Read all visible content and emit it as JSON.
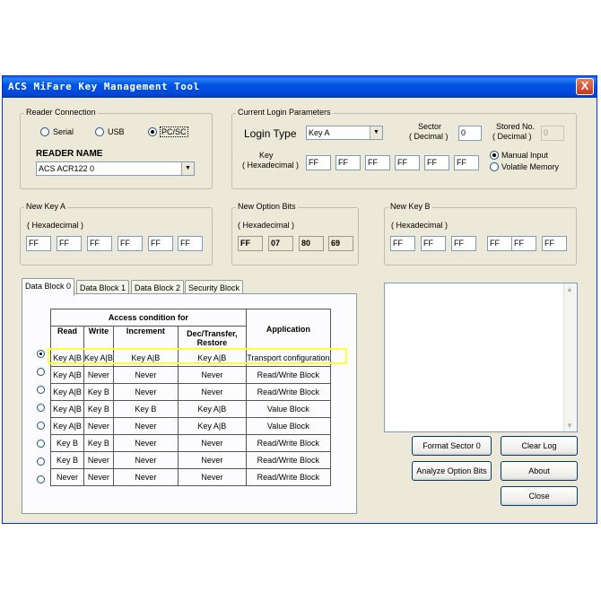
{
  "window": {
    "title": "ACS MiFare Key Management Tool",
    "close_label": "X"
  },
  "reader_connection": {
    "legend": "Reader Connection",
    "options": [
      "Serial",
      "USB",
      "PC/SC"
    ],
    "selected": "PC/SC",
    "reader_name_label": "READER NAME",
    "reader_name_value": "ACS ACR122 0"
  },
  "login": {
    "legend": "Current Login Parameters",
    "login_type_label": "Login Type",
    "login_type_value": "Key A",
    "sector_label_1": "Sector",
    "sector_label_2": "( Decimal )",
    "sector_value": "0",
    "stored_label_1": "Stored No.",
    "stored_label_2": "( Decimal )",
    "stored_value": "0",
    "key_label_1": "Key",
    "key_label_2": "( Hexadecimal )",
    "key_bytes": [
      "FF",
      "FF",
      "FF",
      "FF",
      "FF",
      "FF"
    ],
    "input_modes": [
      "Manual Input",
      "Volatile Memory"
    ],
    "selected_mode": "Manual Input"
  },
  "new_key_a": {
    "legend": "New Key A",
    "hex_label": "( Hexadecimal )",
    "bytes": [
      "FF",
      "FF",
      "FF",
      "FF",
      "FF",
      "FF"
    ]
  },
  "new_option_bits": {
    "legend": "New Option Bits",
    "hex_label": "( Hexadecimal )",
    "bytes": [
      "FF",
      "07",
      "80",
      "69"
    ]
  },
  "new_key_b": {
    "legend": "New Key B",
    "hex_label": "( Hexadecimal )",
    "bytes": [
      "FF",
      "FF",
      "FF",
      "FF",
      "FF",
      "FF"
    ]
  },
  "tabs": [
    "Data Block 0",
    "Data Block 1",
    "Data Block 2",
    "Security Block"
  ],
  "active_tab": "Data Block 0",
  "access_table": {
    "group_header": "Access condition for",
    "app_header": "Application",
    "columns": [
      "Read",
      "Write",
      "Increment",
      "Dec/Transfer, Restore"
    ],
    "rows": [
      [
        "Key A|B",
        "Key A|B",
        "Key A|B",
        "Key A|B",
        "Transport configuration"
      ],
      [
        "Key A|B",
        "Never",
        "Never",
        "Never",
        "Read/Write Block"
      ],
      [
        "Key A|B",
        "Key B",
        "Never",
        "Never",
        "Read/Write Block"
      ],
      [
        "Key A|B",
        "Key B",
        "Key B",
        "Key A|B",
        "Value Block"
      ],
      [
        "Key A|B",
        "Never",
        "Never",
        "Key A|B",
        "Value Block"
      ],
      [
        "Key B",
        "Key B",
        "Never",
        "Never",
        "Read/Write Block"
      ],
      [
        "Key B",
        "Never",
        "Never",
        "Never",
        "Read/Write Block"
      ],
      [
        "Never",
        "Never",
        "Never",
        "Never",
        "Read/Write Block"
      ]
    ],
    "selected_row": 0
  },
  "buttons": {
    "format_sector": "Format Sector 0",
    "clear_log": "Clear Log",
    "analyze_option_bits": "Analyze Option Bits",
    "about": "About",
    "close": "Close"
  },
  "colors": {
    "title_bar": "#0054e3",
    "window_bg": "#ece9d8",
    "highlight": "#ffff3c"
  }
}
